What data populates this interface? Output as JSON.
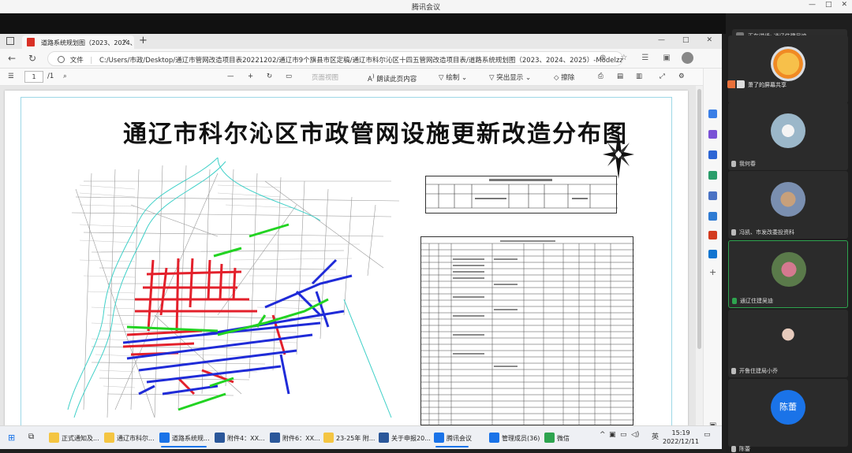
{
  "meeting": {
    "title": "腾讯会议",
    "window_controls": [
      "—",
      "□",
      "✕"
    ]
  },
  "browser": {
    "tab_title": "道路系统规划图（2023、2024、",
    "tab_close": "✕",
    "new_tab": "+",
    "window_controls": [
      "—",
      "□",
      "✕"
    ],
    "url_prefix": "文件",
    "url": "C:/Users/市政/Desktop/通辽市管网改造项目表20221202/通辽市9个旗县市区定稿/通辽市科尔沁区十四五管网改造项目表/道路系统规划图（2023、2024、2025）-Modelzzz..."
  },
  "pdf_toolbar": {
    "page_current": "1",
    "page_total": "/1",
    "zoom_out": "—",
    "zoom_in": "+",
    "page_view": "页面视图",
    "read_aloud": "朗读此页内容",
    "draw": "绘制",
    "highlight": "突出显示",
    "erase": "擦除"
  },
  "document": {
    "map_title": "通辽市科尔沁区市政管网设施更新改造分布图",
    "north_label": "北"
  },
  "taskbar": {
    "items": [
      {
        "label": "正式通知及...",
        "color": "#f4c542"
      },
      {
        "label": "通辽市科尔...",
        "color": "#f4c542"
      },
      {
        "label": "道路系统规...",
        "color": "#1a73e8"
      },
      {
        "label": "附件4：XX...",
        "color": "#2b579a"
      },
      {
        "label": "附件6：XX...",
        "color": "#2b579a"
      },
      {
        "label": "23-25年 附...",
        "color": "#f4c542"
      },
      {
        "label": "关于申报20...",
        "color": "#2b579a"
      },
      {
        "label": "腾讯会议",
        "color": "#1a73e8"
      },
      {
        "label": "管理成员(36)",
        "color": "#1a73e8"
      },
      {
        "label": "微信",
        "color": "#2ea44f"
      }
    ],
    "ime": "英",
    "time": "15:19",
    "date": "2022/12/11"
  },
  "participants": {
    "speaking": "正在讲话: 通辽住建吴迪",
    "sharing": "萧了的屏幕共享",
    "tiles": [
      {
        "name": "萧了的屏幕共享",
        "avatar_color": "#f5a623"
      },
      {
        "name": "我何春",
        "avatar_color": "#9bb7c9"
      },
      {
        "name": "冯凯、市发改委投资科",
        "avatar_color": "#7a8fb0"
      },
      {
        "name": "通辽住建吴迪",
        "avatar_color": "#5a7a4a"
      },
      {
        "name": "开鲁住建局小乔",
        "avatar_color": "#3d3d3d"
      },
      {
        "name": "陈蕾",
        "avatar_color": "#1a73e8"
      }
    ],
    "bottom_name": "陈蕾"
  },
  "colors": {
    "pipe_red": "#e3202b",
    "pipe_blue": "#1f2bd8",
    "pipe_green": "#22d322",
    "river": "#3fd0c8"
  }
}
